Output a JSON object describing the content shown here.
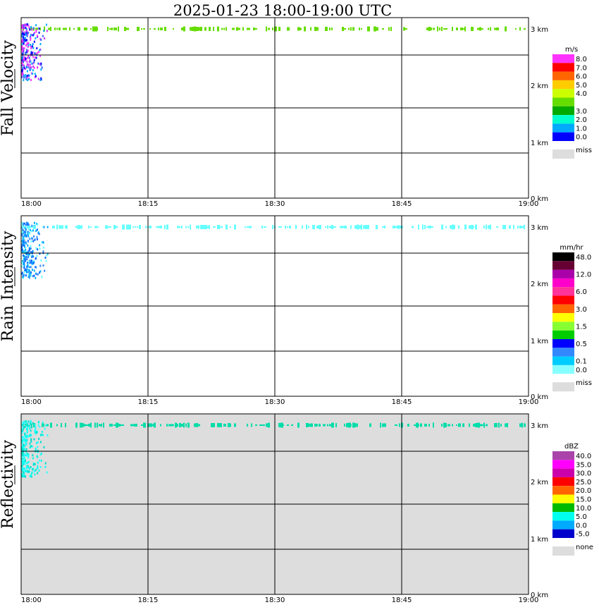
{
  "title": "2025-01-23   18:00-19:00 UTC",
  "x_ticks": [
    "18:00",
    "18:15",
    "18:30",
    "18:45",
    "19:00"
  ],
  "y_ticks": [
    "0 km",
    "1 km",
    "2 km",
    "3 km"
  ],
  "chart_data": [
    {
      "type": "heatmap",
      "ylabel": "Fall Velocity",
      "unit": "m/s",
      "background": "#ffffff",
      "legend": [
        {
          "color": "#ff33ff",
          "label": "8.0"
        },
        {
          "color": "#ff0000",
          "label": "7.0"
        },
        {
          "color": "#ff6600",
          "label": "6.0"
        },
        {
          "color": "#ffcc00",
          "label": "5.0"
        },
        {
          "color": "#ccff00",
          "label": "4.0"
        },
        {
          "color": "#66dd00",
          "label": ""
        },
        {
          "color": "#00aa00",
          "label": "3.0"
        },
        {
          "color": "#00ffcc",
          "label": "2.0"
        },
        {
          "color": "#00aaff",
          "label": "1.0"
        },
        {
          "color": "#0000ff",
          "label": "0.0"
        }
      ],
      "missing_label": "miss",
      "xlim": [
        "18:00",
        "19:00"
      ],
      "ylim_km": [
        0,
        3.2
      ],
      "grid": true,
      "echo_top_km": 3.0,
      "echo_color": "#66dd00",
      "cluster_colors": [
        "#0000ff",
        "#3366ff",
        "#00aaff",
        "#cc33ff",
        "#ff33ff"
      ]
    },
    {
      "type": "heatmap",
      "ylabel": "Rain Intensity",
      "unit": "mm/hr",
      "background": "#ffffff",
      "legend": [
        {
          "color": "#000000",
          "label": "48.0"
        },
        {
          "color": "#660033",
          "label": ""
        },
        {
          "color": "#aa00aa",
          "label": "12.0"
        },
        {
          "color": "#ff00cc",
          "label": ""
        },
        {
          "color": "#ff3399",
          "label": "6.0"
        },
        {
          "color": "#ff0000",
          "label": ""
        },
        {
          "color": "#ff6600",
          "label": "3.0"
        },
        {
          "color": "#ffff00",
          "label": ""
        },
        {
          "color": "#88ff33",
          "label": "1.5"
        },
        {
          "color": "#00cc00",
          "label": ""
        },
        {
          "color": "#0000ff",
          "label": "0.5"
        },
        {
          "color": "#3388ff",
          "label": ""
        },
        {
          "color": "#00ccff",
          "label": "0.1"
        },
        {
          "color": "#88ffff",
          "label": "0.0"
        }
      ],
      "missing_label": "miss",
      "xlim": [
        "18:00",
        "19:00"
      ],
      "ylim_km": [
        0,
        3.2
      ],
      "grid": true,
      "echo_top_km": 3.0,
      "echo_color": "#66ffff",
      "cluster_colors": [
        "#3388ff",
        "#00aaff",
        "#0066ff",
        "#66ffff"
      ]
    },
    {
      "type": "heatmap",
      "ylabel": "Reflectivity",
      "unit": "dBZ",
      "background": "#dddddd",
      "legend": [
        {
          "color": "#aa44aa",
          "label": "40.0"
        },
        {
          "color": "#ff00ff",
          "label": "35.0"
        },
        {
          "color": "#cc00aa",
          "label": "30.0"
        },
        {
          "color": "#ff0000",
          "label": "25.0"
        },
        {
          "color": "#ff6600",
          "label": "20.0"
        },
        {
          "color": "#ffff00",
          "label": "15.0"
        },
        {
          "color": "#00bb00",
          "label": "10.0"
        },
        {
          "color": "#00ffee",
          "label": "5.0"
        },
        {
          "color": "#00aaff",
          "label": "0.0"
        },
        {
          "color": "#0000cc",
          "label": "-5.0"
        }
      ],
      "missing_label": "none",
      "xlim": [
        "18:00",
        "19:00"
      ],
      "ylim_km": [
        0,
        3.2
      ],
      "grid": true,
      "echo_top_km": 3.0,
      "echo_color": "#00ddaa",
      "cluster_colors": [
        "#00ffee",
        "#33ffff",
        "#00ddcc"
      ]
    }
  ]
}
